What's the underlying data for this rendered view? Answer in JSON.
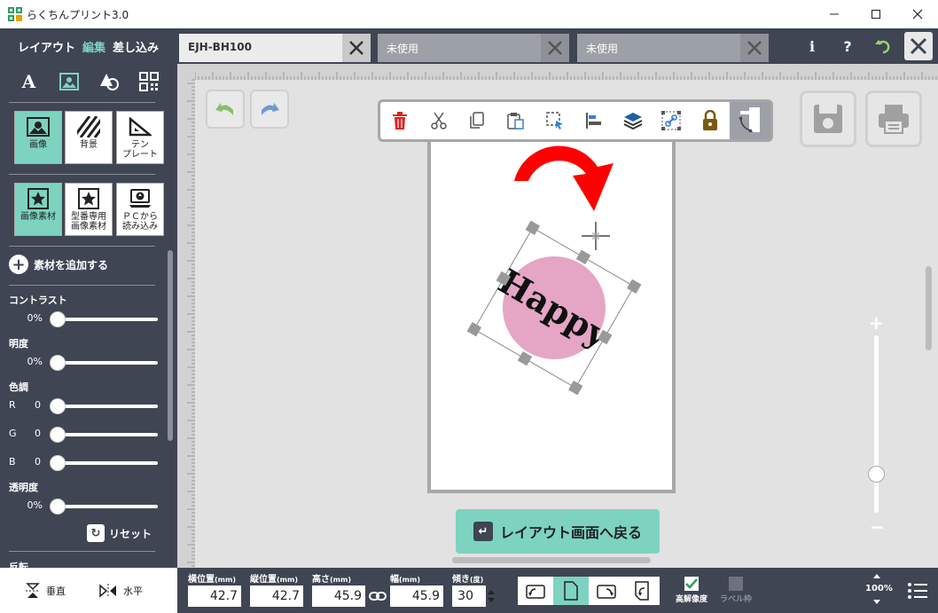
{
  "window": {
    "title": "らくちんプリント3.0",
    "controls": [
      "minimize",
      "maximize",
      "close"
    ]
  },
  "header": {
    "modes": [
      {
        "label": "レイアウト",
        "active": false
      },
      {
        "label": "編集",
        "active": true
      },
      {
        "label": "差し込み",
        "active": false
      }
    ],
    "tabs": [
      {
        "label": "EJH-BH100",
        "active": true
      },
      {
        "label": "未使用",
        "active": false
      },
      {
        "label": "未使用",
        "active": false
      }
    ],
    "icons": [
      "info-icon",
      "help-icon",
      "undo-icon",
      "close-icon"
    ],
    "info_label": "i",
    "help_label": "?"
  },
  "sidebar": {
    "category_icons": [
      "text-icon",
      "image-icon",
      "shape-icon",
      "qrcode-icon"
    ],
    "text_icon_label": "A",
    "tiles_row1": [
      {
        "label": "画像",
        "active": true,
        "icon": "picture-icon"
      },
      {
        "label": "背景",
        "active": false,
        "icon": "stripes-icon"
      },
      {
        "label": "テン\nプレート",
        "active": false,
        "icon": "ruler-triangle-icon"
      }
    ],
    "tiles_row2": [
      {
        "label": "画像素材",
        "active": true,
        "icon": "star-icon"
      },
      {
        "label": "型番専用\n画像素材",
        "active": false,
        "icon": "star-icon"
      },
      {
        "label": "ＰＣから\n読み込み",
        "active": false,
        "icon": "computer-upload-icon"
      }
    ],
    "add_material": "素材を追加する",
    "contrast": {
      "label": "コントラスト",
      "value": "0%",
      "level": 0
    },
    "brightness": {
      "label": "明度",
      "value": "0%",
      "level": 0
    },
    "color_tone": {
      "label": "色調",
      "channels": [
        {
          "name": "R",
          "value": "0",
          "level": 0
        },
        {
          "name": "G",
          "value": "0",
          "level": 0
        },
        {
          "name": "B",
          "value": "0",
          "level": 0
        }
      ]
    },
    "transparency": {
      "label": "透明度",
      "value": "0%",
      "level": 0
    },
    "reset": "リセット",
    "flip": {
      "label": "反転",
      "vertical": "垂直",
      "horizontal": "水平"
    }
  },
  "canvas": {
    "toolbar": [
      {
        "name": "delete-icon",
        "color": "#e02020"
      },
      {
        "name": "cut-icon"
      },
      {
        "name": "copy-icon"
      },
      {
        "name": "paste-icon"
      },
      {
        "name": "select-icon"
      },
      {
        "name": "align-left-icon"
      },
      {
        "name": "layers-icon"
      },
      {
        "name": "link-icon"
      },
      {
        "name": "lock-icon"
      },
      {
        "name": "rotate-handle-icon",
        "active": true
      }
    ],
    "sticker_text": "Happy",
    "sticker_color": "#e4a6c4",
    "rotation_arrow_color": "#ff0000",
    "back_button": "レイアウト画面へ戻る",
    "accent_color": "#7dd3c0",
    "zoom_plus": "+",
    "zoom_minus": "−"
  },
  "bottombar": {
    "fields": [
      {
        "label": "横位置",
        "unit": "(mm)",
        "value": "42.7"
      },
      {
        "label": "縦位置",
        "unit": "(mm)",
        "value": "42.7"
      },
      {
        "label": "高さ",
        "unit": "(mm)",
        "value": "45.9"
      },
      {
        "label": "幅",
        "unit": "(mm)",
        "value": "45.9"
      },
      {
        "label": "傾き",
        "unit": "(度)",
        "value": "30"
      }
    ],
    "orientations": [
      "rotate-left-icon",
      "portrait-icon",
      "rotate-right-icon",
      "rotate-180-icon"
    ],
    "high_resolution": {
      "label": "高解像度",
      "checked": true
    },
    "label_frame": {
      "label": "ラベル枠",
      "checked": false
    },
    "zoom": "100%"
  }
}
